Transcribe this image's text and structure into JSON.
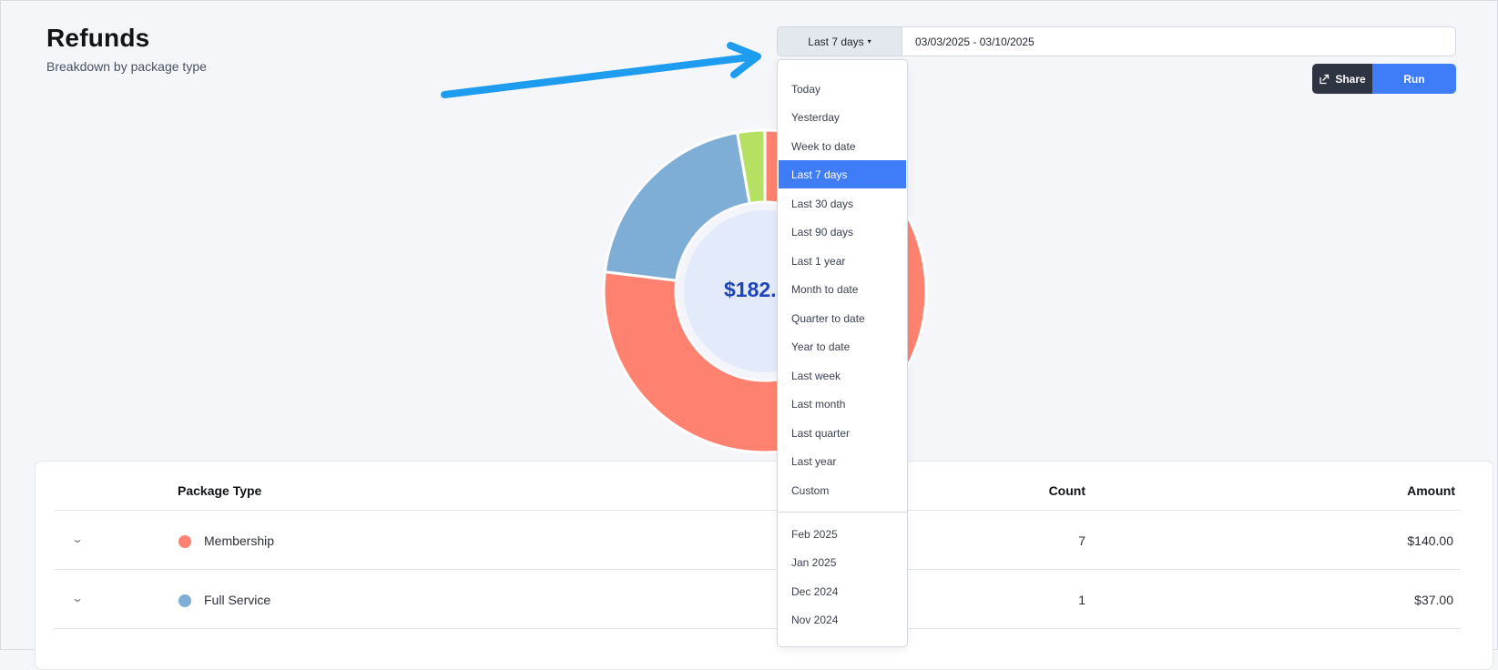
{
  "header": {
    "title": "Refunds",
    "subtitle": "Breakdown by package type"
  },
  "toolbar": {
    "range_label": "Last 7 days",
    "date_range": "03/03/2025 - 03/10/2025",
    "share_label": "Share",
    "run_label": "Run"
  },
  "dropdown": {
    "selected": "Last 7 days",
    "items": [
      "Today",
      "Yesterday",
      "Week to date",
      "Last 7 days",
      "Last 30 days",
      "Last 90 days",
      "Last 1 year",
      "Month to date",
      "Quarter to date",
      "Year to date",
      "Last week",
      "Last month",
      "Last quarter",
      "Last year",
      "Custom"
    ],
    "months": [
      "Feb 2025",
      "Jan 2025",
      "Dec 2024",
      "Nov 2024"
    ]
  },
  "chart_data": {
    "type": "pie",
    "center_label": "$182.",
    "slices": [
      {
        "label": "Membership",
        "value": 140.0,
        "color": "#ff8270"
      },
      {
        "label": "Full Service",
        "value": 37.0,
        "color": "#7eaed6"
      },
      {
        "label": "(unlabeled green)",
        "value": 5.0,
        "color": "#b5e061"
      }
    ]
  },
  "table": {
    "headers": {
      "package_type": "Package Type",
      "count": "Count",
      "amount": "Amount"
    },
    "rows": [
      {
        "name": "Membership",
        "count": "7",
        "amount": "$140.00",
        "color": "#ff8270"
      },
      {
        "name": "Full Service",
        "count": "1",
        "amount": "$37.00",
        "color": "#7eaed6"
      }
    ]
  },
  "colors": {
    "accent": "#3f7cf7",
    "annotation_arrow": "#1e9cf0",
    "donut_center": "#e3ebfb",
    "total_text": "#1f43b8"
  }
}
